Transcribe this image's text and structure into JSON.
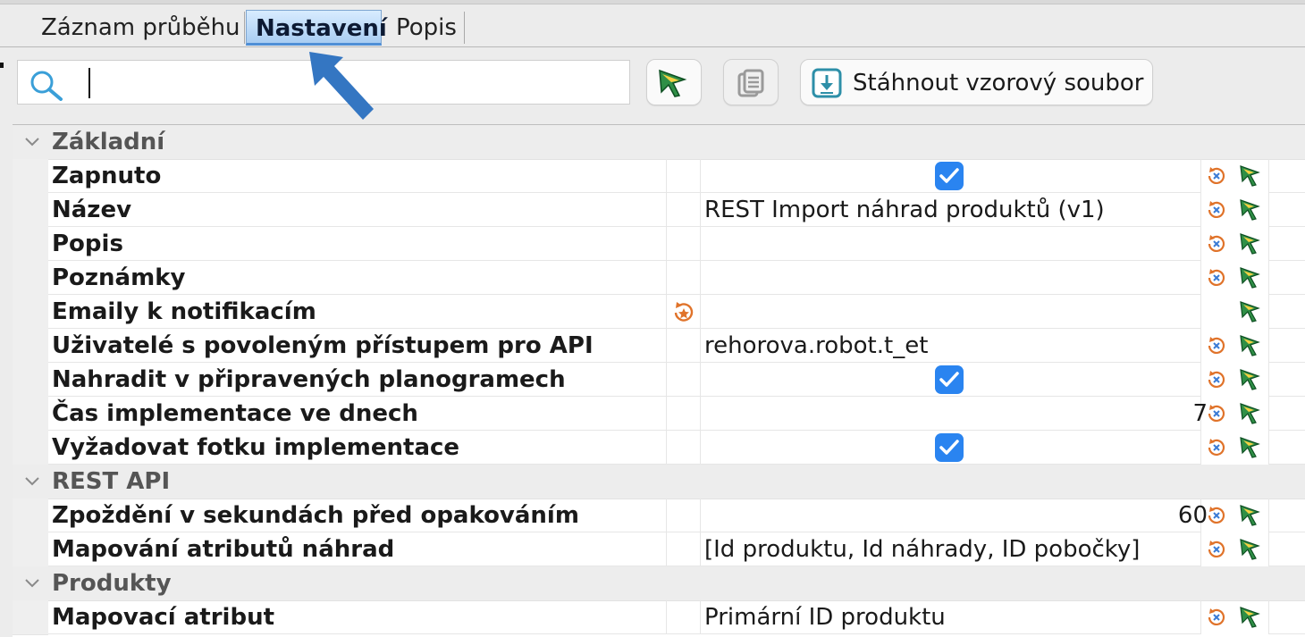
{
  "tabs": [
    {
      "label": "Záznam průběhu"
    },
    {
      "label": "Nastavení"
    },
    {
      "label": "Popis"
    }
  ],
  "search": {
    "value": "",
    "placeholder": ""
  },
  "toolbar": {
    "download_label": "Stáhnout vzorový soubor"
  },
  "sections": {
    "basic": {
      "title": "Základní",
      "rows": [
        {
          "label": "Zapnuto"
        },
        {
          "label": "Název",
          "value": "REST Import náhrad produktů (v1)"
        },
        {
          "label": "Popis",
          "value": ""
        },
        {
          "label": "Poznámky",
          "value": ""
        },
        {
          "label": "Emaily k notifikacím",
          "value": ""
        },
        {
          "label": "Uživatelé s povoleným přístupem pro API",
          "value": "rehorova.robot.t_et"
        },
        {
          "label": "Nahradit v připravených planogramech"
        },
        {
          "label": "Čas implementace ve dnech",
          "value": "7"
        },
        {
          "label": "Vyžadovat fotku implementace"
        }
      ]
    },
    "rest": {
      "title": "REST API",
      "rows": [
        {
          "label": "Zpoždění v sekundách před opakováním",
          "value": "60"
        },
        {
          "label": "Mapování atributů náhrad",
          "value": "[Id produktu, Id náhrady, ID pobočky]"
        }
      ]
    },
    "products": {
      "title": "Produkty",
      "rows": [
        {
          "label": "Mapovací atribut",
          "value": "Primární ID produktu"
        }
      ]
    }
  },
  "checks": {
    "enabled": true,
    "replace_prepared": true,
    "require_photo": true
  },
  "colors": {
    "accent": "#2a84f0",
    "tab_active": "#a9cdf2",
    "arrow": "#3476c2",
    "reset_icon": "#e0732a",
    "pick_icon": "#1f8a3a"
  }
}
